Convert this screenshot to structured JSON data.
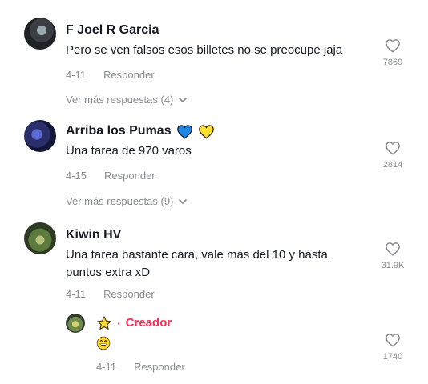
{
  "comments": [
    {
      "author": "F Joel R Garcia",
      "text": "Pero se ven falsos esos billetes no se preocupe jaja",
      "date": "4-11",
      "reply_label": "Responder",
      "likes": "7869",
      "more_replies": "Ver más respuestas (4)"
    },
    {
      "author": "Arriba los Pumas",
      "text": "Una tarea de 970 varos",
      "date": "4-15",
      "reply_label": "Responder",
      "likes": "2814",
      "more_replies": "Ver más respuestas (9)",
      "name_emojis": [
        "blue-heart-icon",
        "yellow-heart-icon"
      ]
    },
    {
      "author": "Kiwin HV",
      "text": "Una tarea bastante cara, vale más del 10 y hasta puntos extra xD",
      "date": "4-11",
      "reply_label": "Responder",
      "likes": "31.9K"
    }
  ],
  "reply": {
    "badge_label": "Creador",
    "separator": "·",
    "date": "4-11",
    "reply_label": "Responder",
    "likes": "1740",
    "name_emoji": "star-icon",
    "body_emoji": "grinning-face-icon"
  },
  "colors": {
    "accent": "#fe2c55",
    "text": "#161823",
    "muted": "#8a8b91"
  }
}
